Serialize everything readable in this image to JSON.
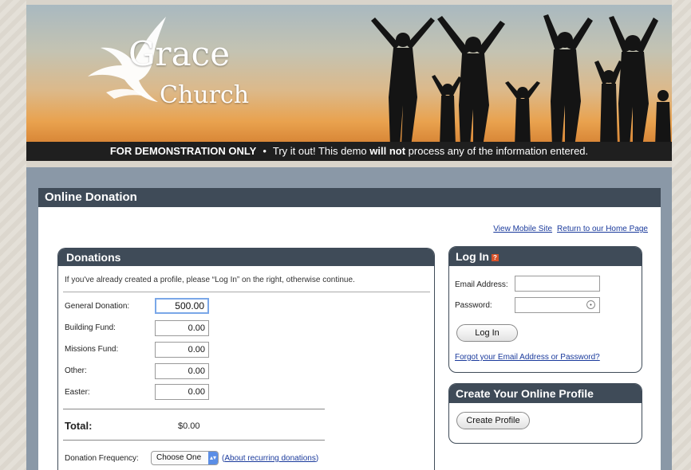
{
  "banner": {
    "logo_line1": "Grace",
    "logo_line2": "Church",
    "demo_strong": "FOR DEMONSTRATION ONLY",
    "demo_bullet": "•",
    "demo_text_a": "Try it out! This demo",
    "demo_text_bold": "will not",
    "demo_text_b": "process any of the information entered."
  },
  "page": {
    "title": "Online Donation",
    "links": [
      "View Mobile Site",
      "Return to our Home Page"
    ]
  },
  "donations": {
    "title": "Donations",
    "intro": "If you've already created a profile, please “Log In” on the right, otherwise continue.",
    "fields": [
      {
        "label": "General Donation:",
        "value": "500.00"
      },
      {
        "label": "Building Fund:",
        "value": "0.00"
      },
      {
        "label": "Missions Fund:",
        "value": "0.00"
      },
      {
        "label": "Other:",
        "value": "0.00"
      },
      {
        "label": "Easter:",
        "value": "0.00"
      }
    ],
    "total_label": "Total:",
    "total_value": "$0.00",
    "frequency_label": "Donation Frequency:",
    "frequency_value": "Choose One",
    "frequency_link": "About recurring donations"
  },
  "login": {
    "title": "Log In",
    "email_label": "Email Address:",
    "password_label": "Password:",
    "login_button": "Log In",
    "forgot_link": "Forgot your Email Address or Password?"
  },
  "profile": {
    "title": "Create Your Online Profile",
    "button": "Create Profile"
  },
  "colors": {
    "header_dark": "#3f4b58",
    "link": "#1a3a9c",
    "frame_bg": "#8a98a7"
  }
}
